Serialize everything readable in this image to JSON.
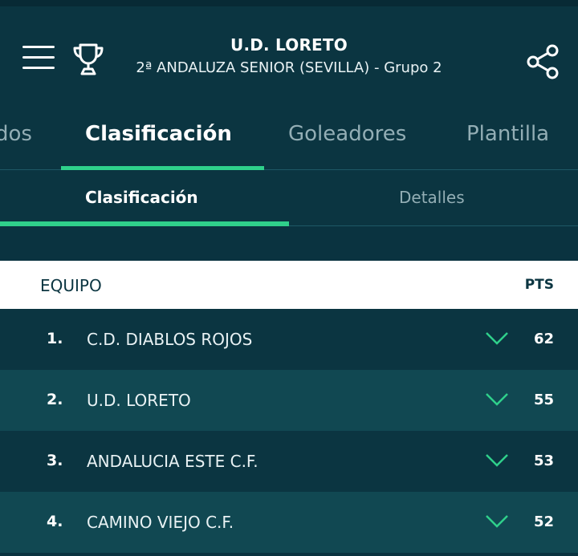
{
  "header": {
    "title": "U.D. LORETO",
    "subtitle": "2ª ANDALUZA SENIOR (SEVILLA) - Grupo 2"
  },
  "tabs": [
    {
      "label": "Resultados",
      "visible_text": "dos"
    },
    {
      "label": "Clasificación"
    },
    {
      "label": "Goleadores"
    },
    {
      "label": "Plantilla"
    }
  ],
  "subtabs": [
    {
      "label": "Clasificación"
    },
    {
      "label": "Detalles"
    }
  ],
  "table": {
    "col_team": "EQUIPO",
    "col_pts": "PTS",
    "rows": [
      {
        "pos": "1.",
        "team": "C.D. DIABLOS ROJOS",
        "pts": "62",
        "trend_icon": "chevron-down-icon"
      },
      {
        "pos": "2.",
        "team": "U.D. LORETO",
        "pts": "55",
        "trend_icon": "chevron-down-icon"
      },
      {
        "pos": "3.",
        "team": "ANDALUCIA ESTE C.F.",
        "pts": "53",
        "trend_icon": "chevron-down-icon"
      },
      {
        "pos": "4.",
        "team": "CAMINO VIEJO C.F.",
        "pts": "52",
        "trend_icon": "chevron-down-icon"
      }
    ]
  },
  "colors": {
    "background": "#0a3340",
    "accent": "#2fd08b",
    "row_alt": "#114852"
  }
}
